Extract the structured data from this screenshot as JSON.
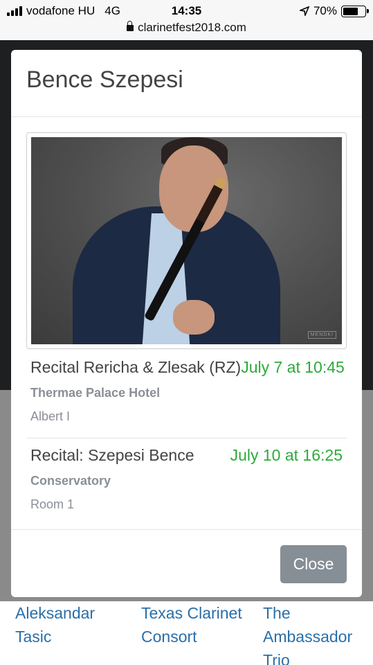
{
  "status_bar": {
    "carrier": "vodafone HU",
    "network": "4G",
    "time": "14:35",
    "battery": "70%",
    "battery_level": 0.7
  },
  "browser": {
    "url": "clarinetfest2018.com"
  },
  "background_links": [
    "Aleksandar Tasic",
    "Texas Clarinet Consort",
    "The Ambassador Trio"
  ],
  "modal": {
    "title": "Bence Szepesi",
    "photo_watermark": "MENDKI",
    "events": [
      {
        "title": "Recital Rericha & Zlesak (RZ)",
        "time": "July 7 at 10:45",
        "venue": "Thermae Palace Hotel",
        "room": "Albert I"
      },
      {
        "title": "Recital: Szepesi Bence",
        "time": "July 10 at 16:25",
        "venue": "Conservatory",
        "room": "Room 1"
      }
    ],
    "close_label": "Close"
  },
  "colors": {
    "time_green": "#2eaa3a",
    "link_blue": "#2a6fa8",
    "button_gray": "#868e96"
  }
}
